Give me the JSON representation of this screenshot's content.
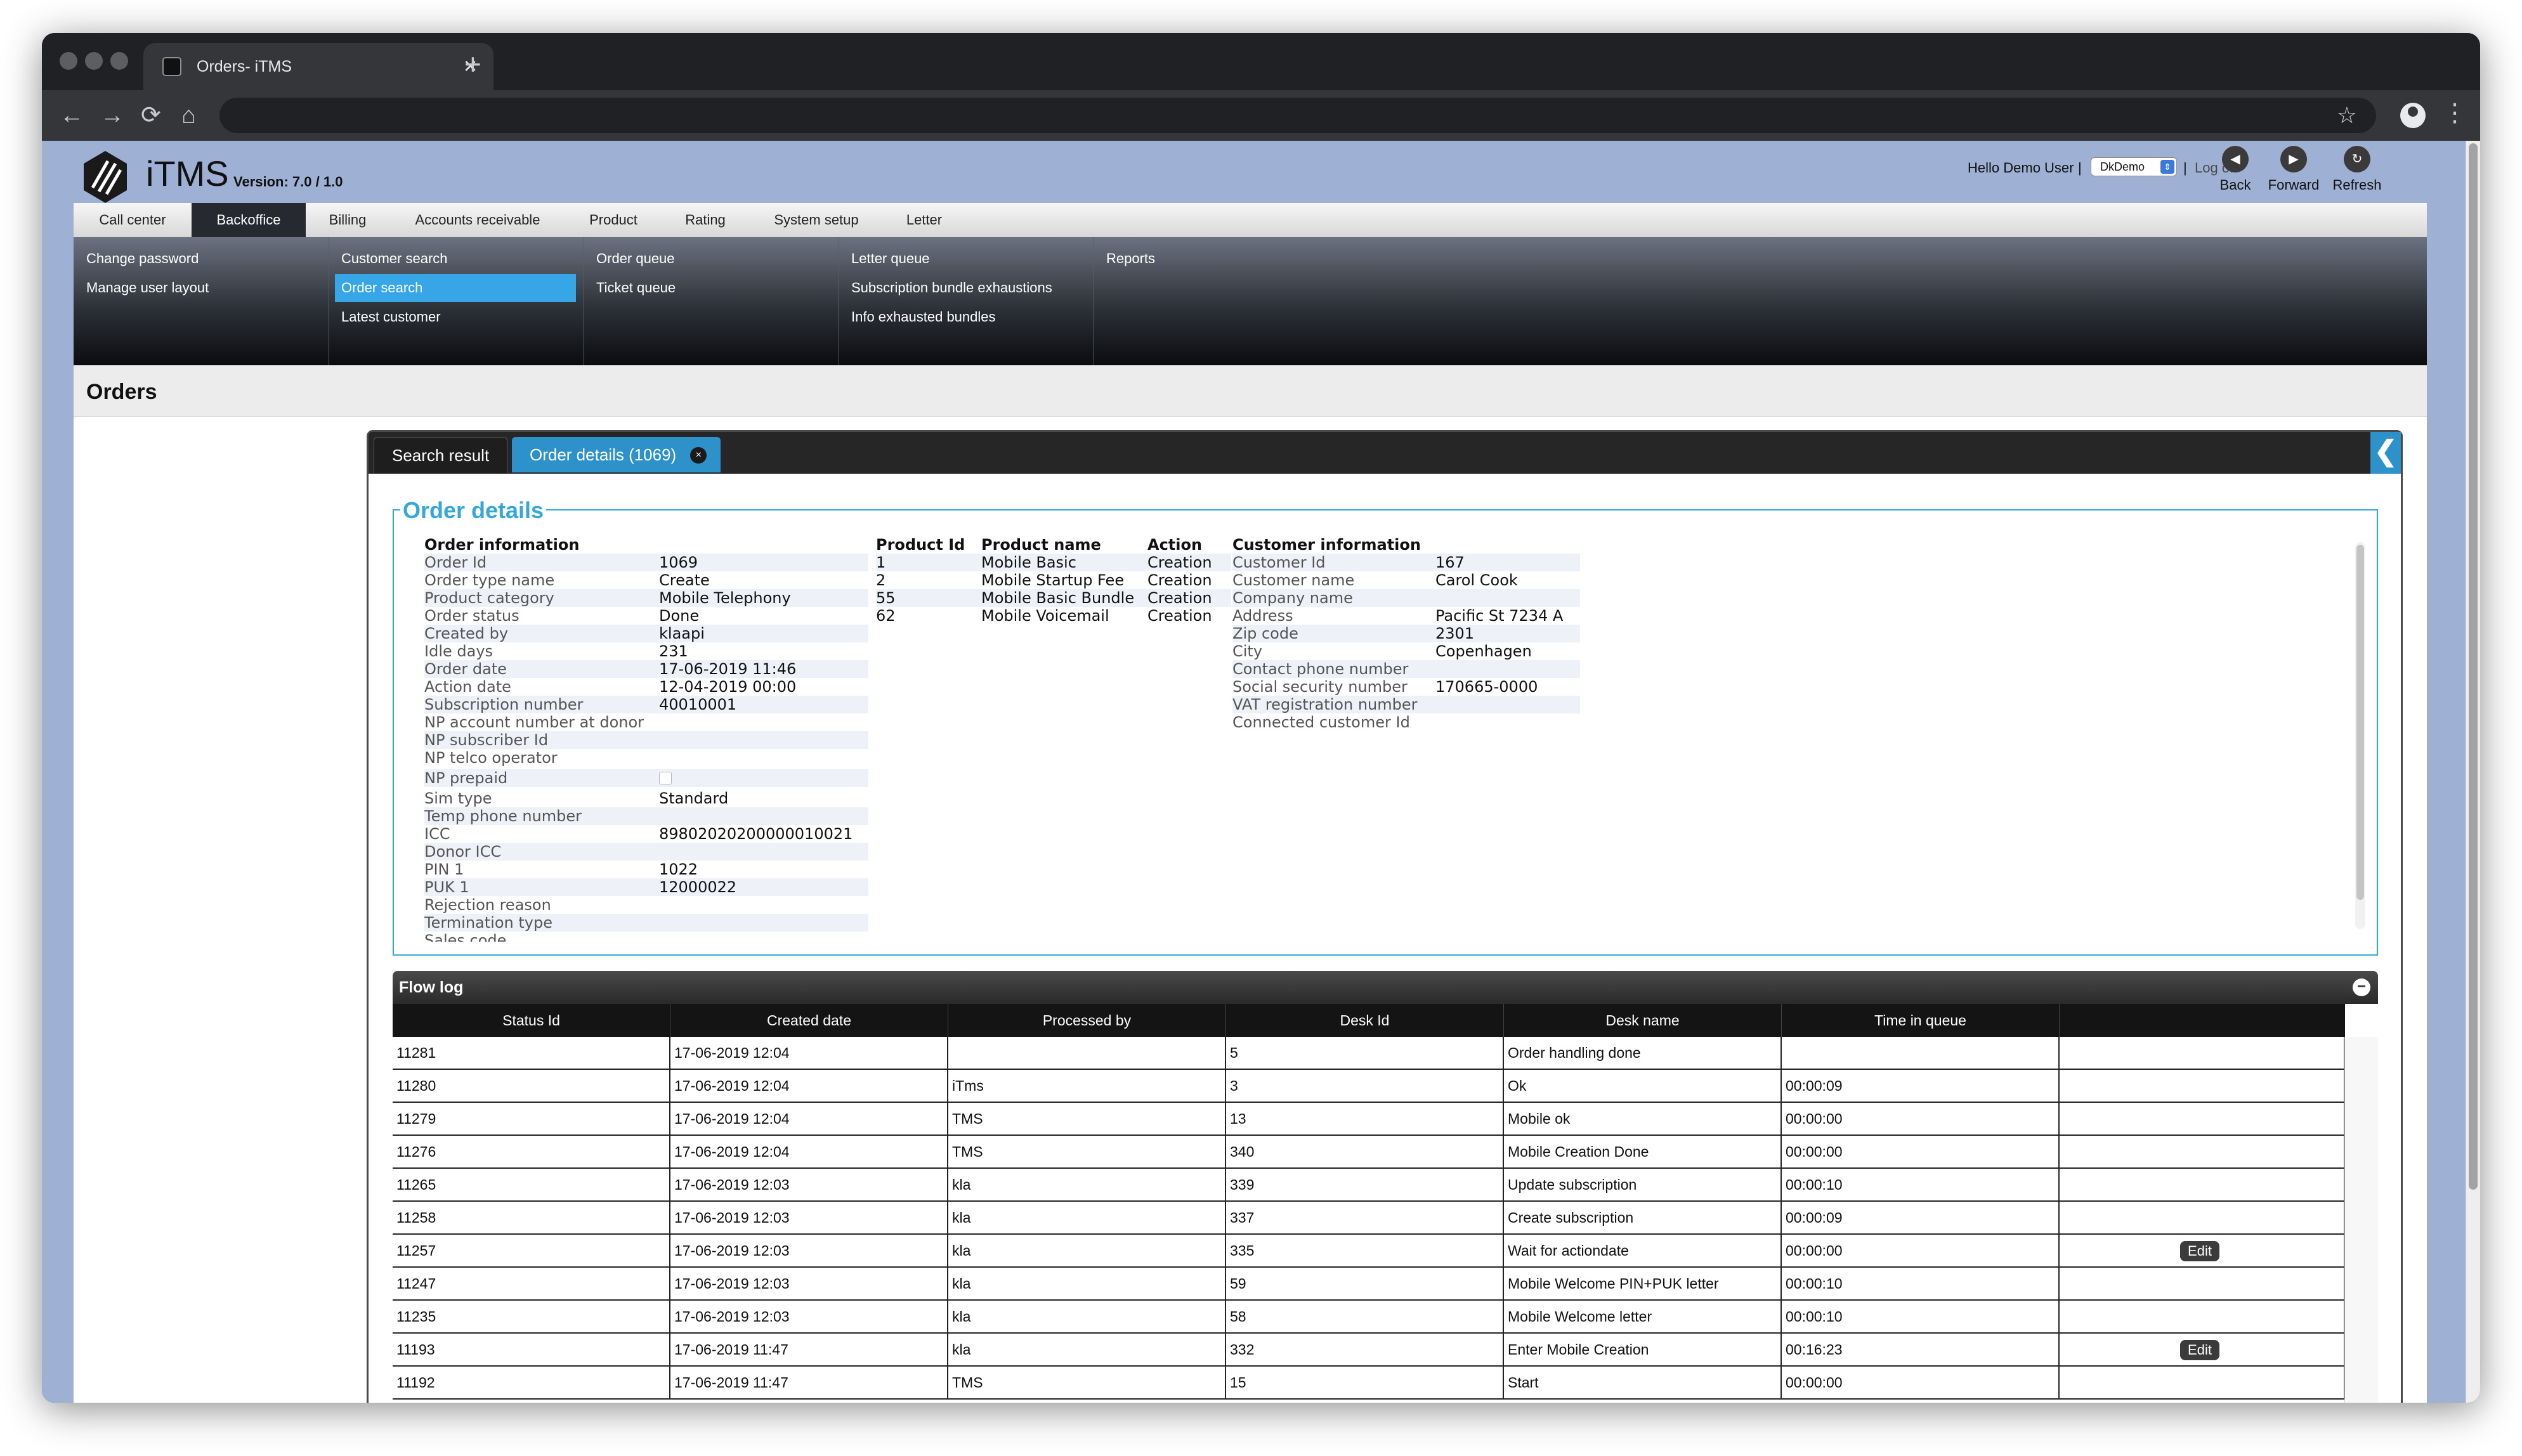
{
  "browser": {
    "tab_title": "Orders- iTMS",
    "close": "×",
    "new_tab": "+",
    "back": "←",
    "forward": "→",
    "reload": "⟳",
    "home": "⌂",
    "star": "☆",
    "menu": "⋮"
  },
  "header": {
    "brand": "iTMS",
    "version": "Version: 7.0 / 1.0",
    "hello": "Hello Demo User",
    "sep": "|",
    "user_select": "DkDemo",
    "select_arrow": "⇕",
    "logoff": "Log off",
    "nav": [
      {
        "label": "Back",
        "glyph": "◀"
      },
      {
        "label": "Forward",
        "glyph": "▶"
      },
      {
        "label": "Refresh",
        "glyph": "↻"
      }
    ]
  },
  "top_menu": [
    "Call center",
    "Backoffice",
    "Billing",
    "Accounts receivable",
    "Product",
    "Rating",
    "System setup",
    "Letter"
  ],
  "sub_menu": [
    [
      "Change password",
      "Manage user layout"
    ],
    [
      "Customer search",
      "Order search",
      "Latest customer"
    ],
    [
      "Order queue",
      "Ticket queue"
    ],
    [
      "Letter queue",
      "Subscription bundle exhaustions",
      "Info exhausted bundles"
    ],
    [
      "Reports"
    ]
  ],
  "page_title": "Orders",
  "panel_tabs": {
    "search_result": "Search result",
    "order_details": "Order details (1069)",
    "close": "×",
    "collapse": "❮"
  },
  "order_details": {
    "legend": "Order details",
    "order_info_title": "Order information",
    "order_info": [
      {
        "label": "Order Id",
        "value": "1069"
      },
      {
        "label": "Order type name",
        "value": "Create"
      },
      {
        "label": "Product category",
        "value": "Mobile Telephony"
      },
      {
        "label": "Order status",
        "value": "Done"
      },
      {
        "label": "Created by",
        "value": "klaapi"
      },
      {
        "label": "Idle days",
        "value": "231"
      },
      {
        "label": "Order date",
        "value": "17-06-2019 11:46"
      },
      {
        "label": "Action date",
        "value": "12-04-2019 00:00"
      },
      {
        "label": "Subscription number",
        "value": "40010001"
      },
      {
        "label": "NP account number at donor",
        "value": ""
      },
      {
        "label": "NP subscriber Id",
        "value": ""
      },
      {
        "label": "NP telco operator",
        "value": ""
      },
      {
        "label": "NP prepaid",
        "value": ""
      },
      {
        "label": "Sim type",
        "value": "Standard"
      },
      {
        "label": "Temp phone number",
        "value": ""
      },
      {
        "label": "ICC",
        "value": "89802020200000010021"
      },
      {
        "label": "Donor ICC",
        "value": ""
      },
      {
        "label": "PIN 1",
        "value": "1022"
      },
      {
        "label": "PUK 1",
        "value": "12000022"
      },
      {
        "label": "Rejection reason",
        "value": ""
      },
      {
        "label": "Termination type",
        "value": ""
      },
      {
        "label": "Sales code",
        "value": ""
      }
    ],
    "products_headers": [
      "Product Id",
      "Product name",
      "Action"
    ],
    "products": [
      {
        "id": "1",
        "name": "Mobile Basic",
        "action": "Creation"
      },
      {
        "id": "2",
        "name": "Mobile Startup Fee",
        "action": "Creation"
      },
      {
        "id": "55",
        "name": "Mobile Basic Bundle",
        "action": "Creation"
      },
      {
        "id": "62",
        "name": "Mobile Voicemail",
        "action": "Creation"
      }
    ],
    "customer_info_title": "Customer information",
    "customer_info": [
      {
        "label": "Customer Id",
        "value": "167"
      },
      {
        "label": "Customer name",
        "value": "Carol Cook"
      },
      {
        "label": "Company name",
        "value": ""
      },
      {
        "label": "Address",
        "value": "Pacific St 7234 A"
      },
      {
        "label": "Zip code",
        "value": "2301"
      },
      {
        "label": "City",
        "value": "Copenhagen"
      },
      {
        "label": "Contact phone number",
        "value": ""
      },
      {
        "label": "Social security number",
        "value": "170665-0000"
      },
      {
        "label": "VAT registration number",
        "value": ""
      },
      {
        "label": "Connected customer Id",
        "value": ""
      }
    ]
  },
  "flow_log": {
    "title": "Flow log",
    "minimize": "−",
    "columns": [
      "Status Id",
      "Created date",
      "Processed by",
      "Desk Id",
      "Desk name",
      "Time in queue",
      ""
    ],
    "rows": [
      {
        "status_id": "11281",
        "created": "17-06-2019 12:04",
        "processed_by": "",
        "desk_id": "5",
        "desk_name": "Order handling done",
        "time": "",
        "edit": ""
      },
      {
        "status_id": "11280",
        "created": "17-06-2019 12:04",
        "processed_by": "iTms",
        "desk_id": "3",
        "desk_name": "Ok",
        "time": "00:00:09",
        "edit": ""
      },
      {
        "status_id": "11279",
        "created": "17-06-2019 12:04",
        "processed_by": "TMS",
        "desk_id": "13",
        "desk_name": "Mobile ok",
        "time": "00:00:00",
        "edit": ""
      },
      {
        "status_id": "11276",
        "created": "17-06-2019 12:04",
        "processed_by": "TMS",
        "desk_id": "340",
        "desk_name": "Mobile Creation Done",
        "time": "00:00:00",
        "edit": ""
      },
      {
        "status_id": "11265",
        "created": "17-06-2019 12:03",
        "processed_by": "kla",
        "desk_id": "339",
        "desk_name": "Update subscription",
        "time": "00:00:10",
        "edit": ""
      },
      {
        "status_id": "11258",
        "created": "17-06-2019 12:03",
        "processed_by": "kla",
        "desk_id": "337",
        "desk_name": "Create subscription",
        "time": "00:00:09",
        "edit": ""
      },
      {
        "status_id": "11257",
        "created": "17-06-2019 12:03",
        "processed_by": "kla",
        "desk_id": "335",
        "desk_name": "Wait for actiondate",
        "time": "00:00:00",
        "edit": "Edit"
      },
      {
        "status_id": "11247",
        "created": "17-06-2019 12:03",
        "processed_by": "kla",
        "desk_id": "59",
        "desk_name": "Mobile Welcome PIN+PUK letter",
        "time": "00:00:10",
        "edit": ""
      },
      {
        "status_id": "11235",
        "created": "17-06-2019 12:03",
        "processed_by": "kla",
        "desk_id": "58",
        "desk_name": "Mobile Welcome letter",
        "time": "00:00:10",
        "edit": ""
      },
      {
        "status_id": "11193",
        "created": "17-06-2019 11:47",
        "processed_by": "kla",
        "desk_id": "332",
        "desk_name": "Enter Mobile Creation",
        "time": "00:16:23",
        "edit": "Edit"
      },
      {
        "status_id": "11192",
        "created": "17-06-2019 11:47",
        "processed_by": "TMS",
        "desk_id": "15",
        "desk_name": "Start",
        "time": "00:00:00",
        "edit": ""
      }
    ]
  }
}
